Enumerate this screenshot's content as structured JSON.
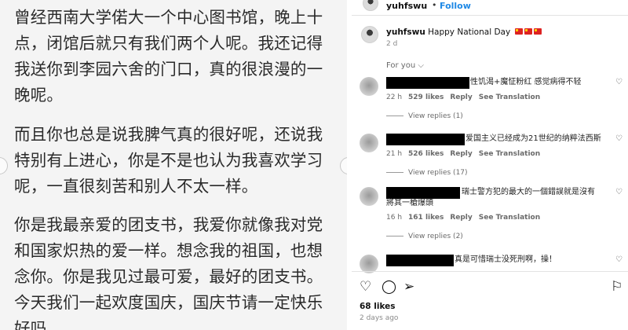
{
  "post_image": {
    "paragraphs": [
      "曾经西南大学偌大一个中心图书馆，晚上十点，闭馆后就只有我们两个人呢。我还记得我送你到李园六舍的门口，真的很浪漫的一晚呢。",
      "而且你也总是说我脾气真的很好呢，还说我特别有上进心，你是不是也认为我喜欢学习呢，一直很刻苦和别人不太一样。",
      "你是我最亲爱的团支书，我爱你就像我对党和国家炽热的爱一样。想念我的祖国，也想念你。你是我见过最可爱，最好的团支书。今天我们一起欢度国庆，国庆节请一定快乐好吗。"
    ]
  },
  "header": {
    "username": "yuhfswu",
    "separator": "•",
    "follow_label": "Follow"
  },
  "caption": {
    "username": "yuhfswu",
    "text": "Happy National Day",
    "time": "2 d"
  },
  "sort": {
    "label": "For you ⌵"
  },
  "comments": [
    {
      "text": "性饥渴+魔怔粉红 感觉病得不轻",
      "time": "22 h",
      "likes": "529 likes",
      "reply": "Reply",
      "translation": "See Translation",
      "replies": "View replies (1)"
    },
    {
      "text": "爱国主义已经成为21世纪的纳粹法西斯",
      "time": "21 h",
      "likes": "526 likes",
      "reply": "Reply",
      "translation": "See Translation",
      "replies": "View replies (17)"
    },
    {
      "text": "瑞士警方犯的最大的一個錯誤就是沒有將其一槍爆頭",
      "time": "16 h",
      "likes": "161 likes",
      "reply": "Reply",
      "translation": "See Translation",
      "replies": "View replies (2)"
    },
    {
      "text": "真是可惜瑞士没死刑啊，操！"
    }
  ],
  "footer": {
    "likes": "68 likes",
    "time": "2 days ago"
  },
  "icons": {
    "heart": "heart-icon",
    "comment": "comment-icon",
    "share": "share-icon",
    "save": "bookmark-icon"
  }
}
